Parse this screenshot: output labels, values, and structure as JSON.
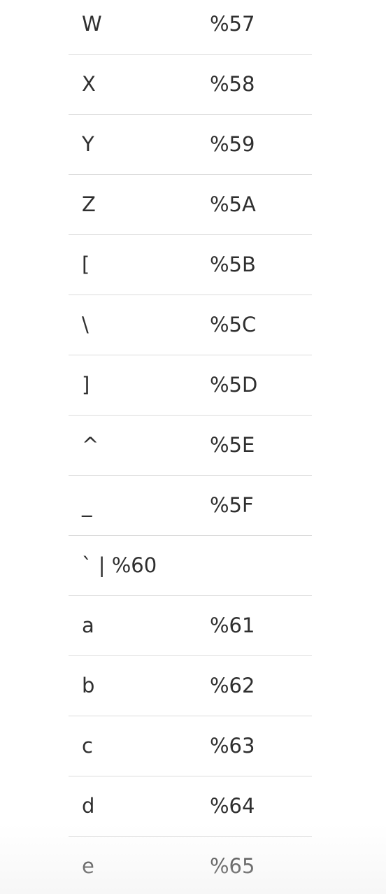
{
  "table": {
    "rows": [
      {
        "char": "W",
        "code": "%57"
      },
      {
        "char": "X",
        "code": "%58"
      },
      {
        "char": "Y",
        "code": "%59"
      },
      {
        "char": "Z",
        "code": "%5A"
      },
      {
        "char": "[",
        "code": "%5B"
      },
      {
        "char": "\\",
        "code": "%5C"
      },
      {
        "char": "]",
        "code": "%5D"
      },
      {
        "char": "^",
        "code": "%5E"
      },
      {
        "char": "_",
        "code": "%5F"
      },
      {
        "char": "` | %60",
        "code": ""
      },
      {
        "char": "a",
        "code": "%61"
      },
      {
        "char": "b",
        "code": "%62"
      },
      {
        "char": "c",
        "code": "%63"
      },
      {
        "char": "d",
        "code": "%64"
      },
      {
        "char": "e",
        "code": "%65"
      }
    ]
  }
}
